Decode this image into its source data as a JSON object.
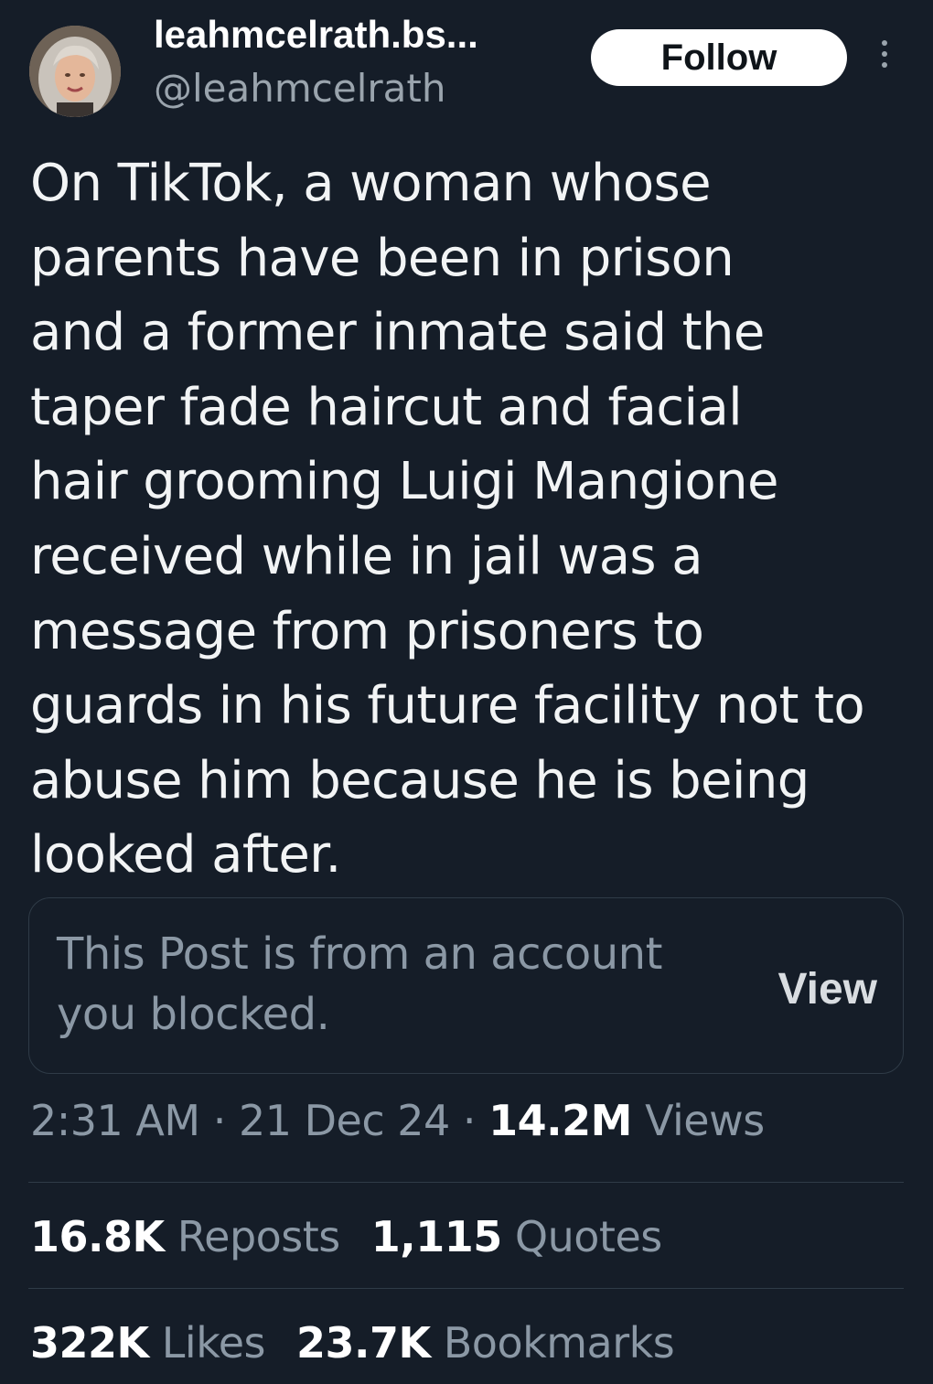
{
  "author": {
    "display_name": "leahmcelrath.bs...",
    "handle": "@leahmcelrath",
    "follow_label": "Follow"
  },
  "tweet": {
    "text_lines": [
      "On TikTok, a woman whose",
      "parents have been in prison",
      "and a former inmate said the",
      "taper fade haircut and facial",
      "hair grooming Luigi Mangione",
      "received while in jail was a",
      "message from prisoners to",
      "guards in his future facility not to",
      "abuse him because he is being",
      "looked after."
    ]
  },
  "blocked_card": {
    "line1": "This Post is from an account",
    "line2": "you blocked.",
    "view_label": "View"
  },
  "meta": {
    "time": "2:31 AM",
    "separator": "·",
    "date": "21 Dec 24",
    "views_count": "14.2M",
    "views_label": "Views"
  },
  "stats": {
    "reposts_count": "16.8K",
    "reposts_label": "Reposts",
    "quotes_count": "1,115",
    "quotes_label": "Quotes",
    "likes_count": "322K",
    "likes_label": "Likes",
    "bookmarks_count": "23.7K",
    "bookmarks_label": "Bookmarks"
  }
}
